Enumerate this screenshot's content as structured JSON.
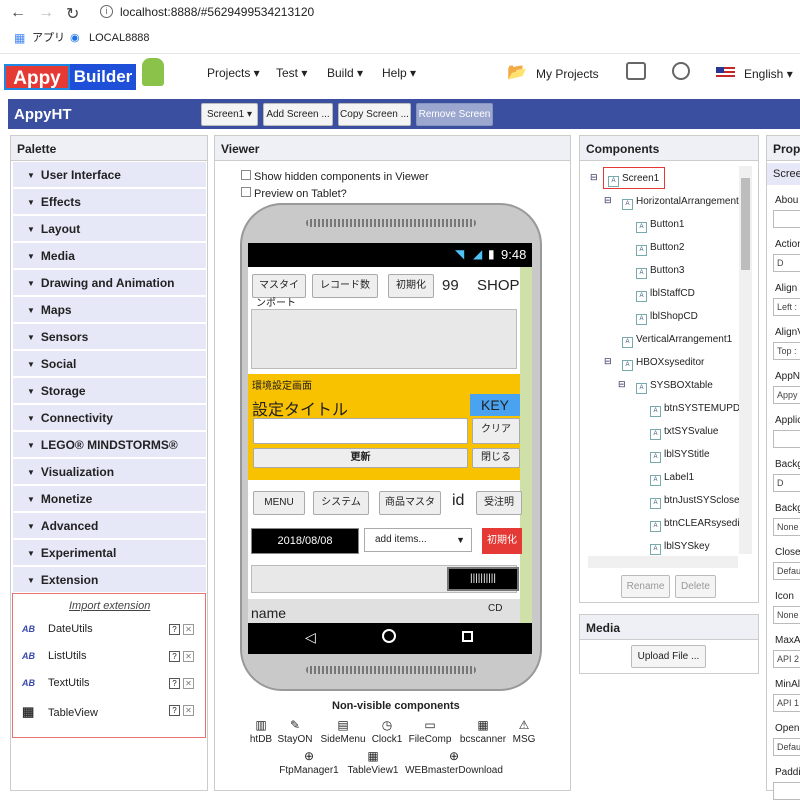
{
  "browser": {
    "url": "localhost:8888/#5629499534213120",
    "bookmarks": [
      "アプリ",
      "LOCAL8888"
    ]
  },
  "nav": {
    "brand_left": "Appy",
    "brand_right": "Builder",
    "menus": [
      "Projects ▾",
      "Test ▾",
      "Build ▾",
      "Help ▾"
    ],
    "my_projects": "My Projects",
    "language": "English ▾"
  },
  "titlebar": {
    "app": "AppyHT",
    "screen_select": "Screen1 ▾",
    "add_screen": "Add Screen ...",
    "copy_screen": "Copy Screen ...",
    "remove_screen": "Remove Screen"
  },
  "palette": {
    "title": "Palette",
    "items": [
      "User Interface",
      "Effects",
      "Layout",
      "Media",
      "Drawing and Animation",
      "Maps",
      "Sensors",
      "Social",
      "Storage",
      "Connectivity",
      "LEGO® MINDSTORMS®",
      "Visualization",
      "Monetize",
      "Advanced",
      "Experimental",
      "Extension"
    ],
    "import_link": "Import extension",
    "extensions": [
      "DateUtils",
      "ListUtils",
      "TextUtils",
      "TableView"
    ]
  },
  "viewer": {
    "title": "Viewer",
    "show_hidden": "Show hidden components in Viewer",
    "preview_tablet": "Preview on Tablet?",
    "time": "9:48",
    "row1": [
      "マスタイ",
      "レコード数",
      "初期化",
      "99",
      "SHOP"
    ],
    "row1_sub": "ンポート",
    "settings_label": "環境設定画面",
    "settings_title": "設定タイトル",
    "key_label": "KEY",
    "clear_btn": "クリア",
    "update_btn": "更新",
    "close_btn": "閉じる",
    "row3": [
      "MENU",
      "システム",
      "商品マスタ",
      "id",
      "受注明"
    ],
    "date": "2018/08/08",
    "add_items": "add items...",
    "init_btn": "初期化",
    "barcode": "||||||||||",
    "name_label": "name",
    "cd_label": "CD",
    "nonvisible_title": "Non-visible components",
    "nonvisible": [
      "htDB",
      "StayON",
      "SideMenu",
      "Clock1",
      "FileComp",
      "bcscanner",
      "MSG",
      "FtpManager1",
      "TableView1",
      "WEBmasterDownload"
    ]
  },
  "components": {
    "title": "Components",
    "tree": [
      {
        "label": "Screen1",
        "depth": 0,
        "expand": "⊟"
      },
      {
        "label": "HorizontalArrangement",
        "depth": 1,
        "expand": "⊟"
      },
      {
        "label": "Button1",
        "depth": 2
      },
      {
        "label": "Button2",
        "depth": 2
      },
      {
        "label": "Button3",
        "depth": 2
      },
      {
        "label": "lblStaffCD",
        "depth": 2
      },
      {
        "label": "lblShopCD",
        "depth": 2
      },
      {
        "label": "VerticalArrangement1",
        "depth": 1
      },
      {
        "label": "HBOXsyseditor",
        "depth": 1,
        "expand": "⊟"
      },
      {
        "label": "SYSBOXtable",
        "depth": 2,
        "expand": "⊟"
      },
      {
        "label": "btnSYSTEMUPD",
        "depth": 3
      },
      {
        "label": "txtSYSvalue",
        "depth": 3
      },
      {
        "label": "lblSYStitle",
        "depth": 3
      },
      {
        "label": "Label1",
        "depth": 3
      },
      {
        "label": "btnJustSYSclose",
        "depth": 3
      },
      {
        "label": "btnCLEARsysedi",
        "depth": 3
      },
      {
        "label": "lblSYSkey",
        "depth": 3
      }
    ],
    "rename": "Rename",
    "delete": "Delete"
  },
  "media": {
    "title": "Media",
    "upload": "Upload File ..."
  },
  "properties": {
    "title": "Prope",
    "screen": "Scree",
    "items": [
      {
        "label": "Abou",
        "value": ""
      },
      {
        "label": "Action",
        "value": "D"
      },
      {
        "label": "Align",
        "value": "Left :"
      },
      {
        "label": "AlignV",
        "value": "Top :"
      },
      {
        "label": "AppN",
        "value": "Appy"
      },
      {
        "label": "Applic",
        "value": ""
      },
      {
        "label": "Backg",
        "value": "D"
      },
      {
        "label": "Backg",
        "value": "None"
      },
      {
        "label": "Close",
        "value": "Defau"
      },
      {
        "label": "Icon",
        "value": "None"
      },
      {
        "label": "MaxA",
        "value": "API 2"
      },
      {
        "label": "MinAl",
        "value": "API 1"
      },
      {
        "label": "Open",
        "value": "Defau"
      },
      {
        "label": "Paddi",
        "value": ""
      }
    ]
  },
  "colors": {
    "brand_blue": "#3a4fa0",
    "accent_yellow": "#f9c200",
    "key_blue": "#4aa3f0",
    "red": "#e53935"
  }
}
